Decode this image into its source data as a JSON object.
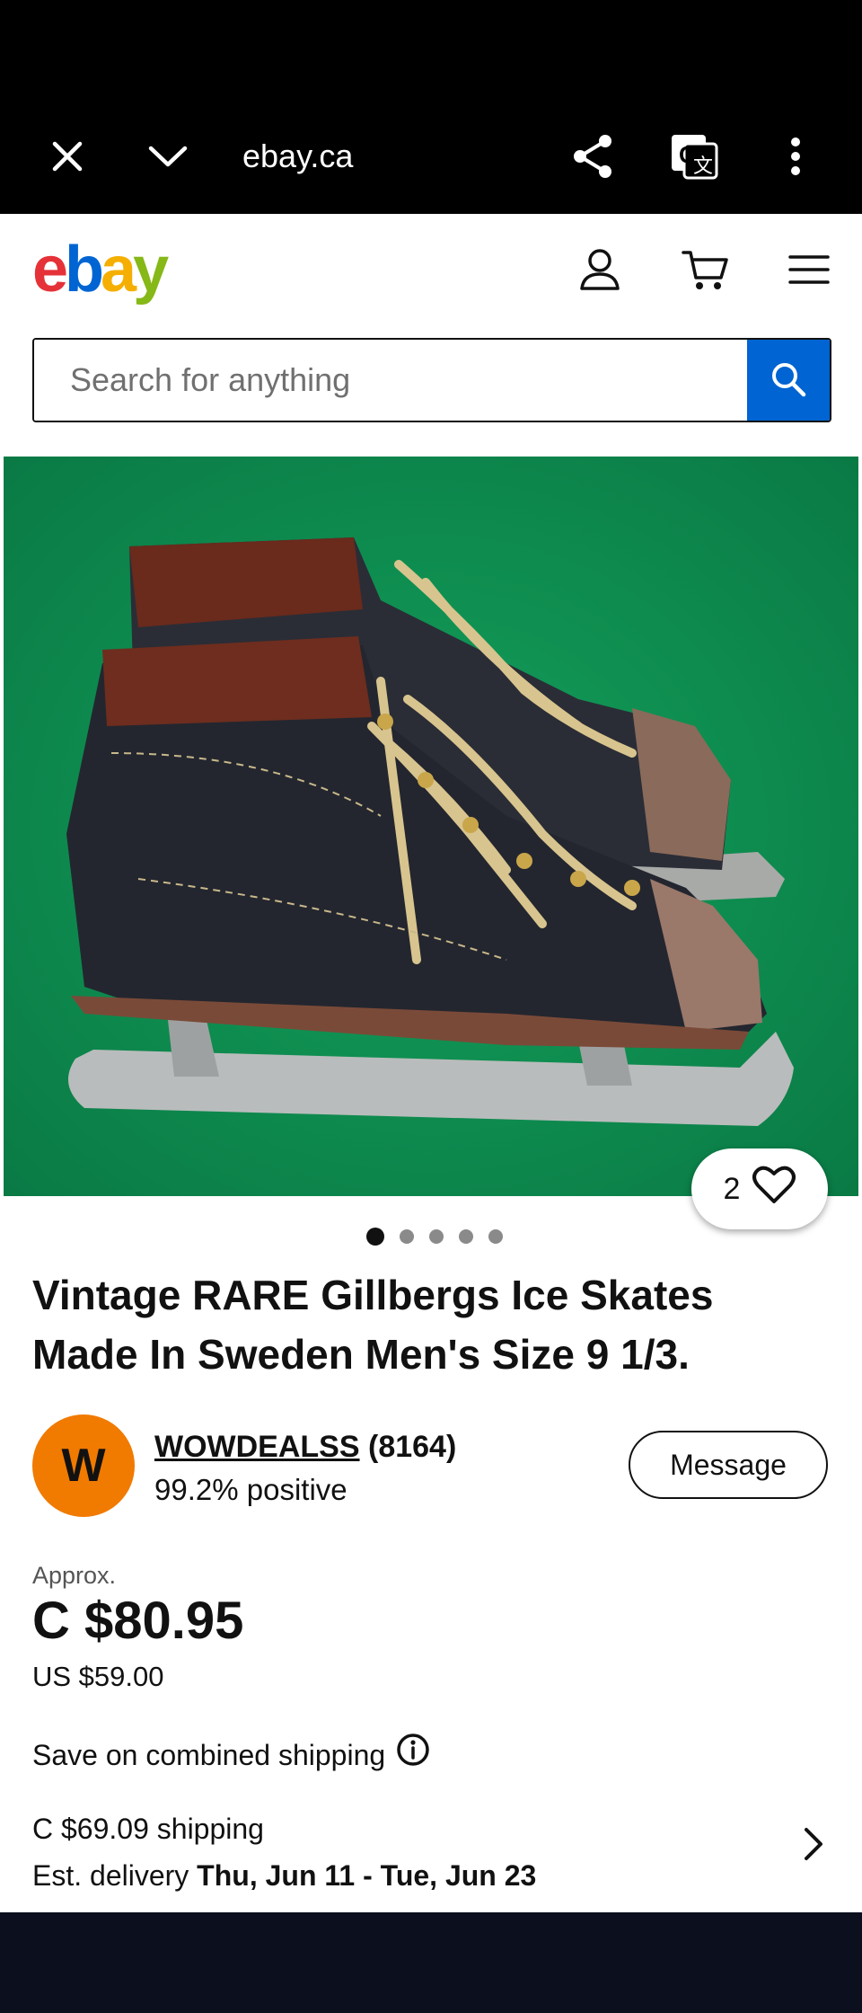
{
  "browser": {
    "url": "ebay.ca",
    "icons": [
      "close-icon",
      "chevron-down-icon",
      "share-icon",
      "translate-icon",
      "more-vert-icon"
    ]
  },
  "header": {
    "logo": {
      "e": "e",
      "b": "b",
      "a": "a",
      "y": "y"
    },
    "icons": [
      "account-icon",
      "cart-icon",
      "menu-icon"
    ]
  },
  "search": {
    "placeholder": "Search for anything",
    "button_icon": "search-icon",
    "accent": "#0064d2"
  },
  "listing": {
    "image_count": 5,
    "active_image": 1,
    "watchers": "2",
    "title": "Vintage RARE Gillbergs Ice Skates Made In Sweden Men's Size 9 1/3."
  },
  "seller": {
    "initial": "W",
    "name": "WOWDEALSS",
    "feedback_count": "(8164)",
    "positive": "99.2% positive",
    "message_label": "Message",
    "avatar_color": "#f17a00"
  },
  "price": {
    "approx_label": "Approx.",
    "cad": "C $80.95",
    "usd": "US $59.00"
  },
  "shipping": {
    "combined": "Save on combined shipping",
    "cost": "C $69.09 shipping",
    "delivery_label": "Est. delivery",
    "delivery_range": "Thu, Jun 11 - Tue, Jun 23"
  }
}
